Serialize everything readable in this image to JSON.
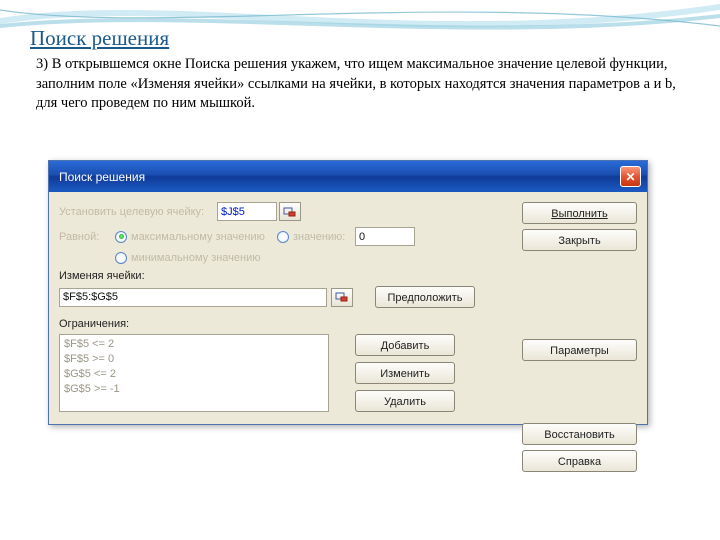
{
  "slide": {
    "title": "Поиск решения",
    "step_num": "3)",
    "body": "В открывшемся окне Поиска решения укажем, что ищем максимальное значение целевой функции, заполним поле «Изменяя ячейки» ссылками на ячейки, в которых находятся значения параметров a и b, для чего проведем по ним мышкой."
  },
  "dialog": {
    "title": "Поиск решения",
    "target_label": "Установить целевую ячейку:",
    "target_value": "$J$5",
    "equal_label": "Равной:",
    "radios": {
      "max": "максимальному значению",
      "val": "значению:",
      "min": "минимальному значению"
    },
    "value_input": "0",
    "changing_label": "Изменяя ячейки:",
    "changing_value": "$F$5:$G$5",
    "constraints_label": "Ограничения:",
    "constraints": [
      "$F$5 <= 2",
      "$F$5 >= 0",
      "$G$5 <= 2",
      "$G$5 >= -1"
    ],
    "buttons": {
      "execute": "Выполнить",
      "close": "Закрыть",
      "guess": "Предположить",
      "params": "Параметры",
      "add": "Добавить",
      "change": "Изменить",
      "delete": "Удалить",
      "restore": "Восстановить",
      "help": "Справка"
    }
  }
}
